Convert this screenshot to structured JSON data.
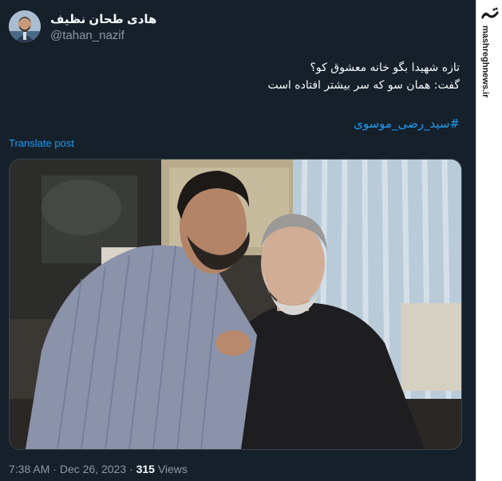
{
  "post": {
    "display_name": "هادی طحان نظیف",
    "handle": "@tahan_nazif",
    "text_line1": "تازه شهیدا بگو خانه معشوق کو؟",
    "text_line2": "گفت: همان سو که سر بیشتر افتاده است",
    "hashtag": "#سید_رضی_موسوی",
    "translate_label": "Translate post",
    "time": "7:38 AM",
    "separator": "·",
    "date": "Dec 26, 2023",
    "views_count": "315",
    "views_label": "Views"
  },
  "watermark": {
    "site": "mashreghnews.ir",
    "logo": "مشرق"
  },
  "colors": {
    "background": "#15202b",
    "link": "#1d9bf0",
    "muted": "#8b98a5"
  }
}
